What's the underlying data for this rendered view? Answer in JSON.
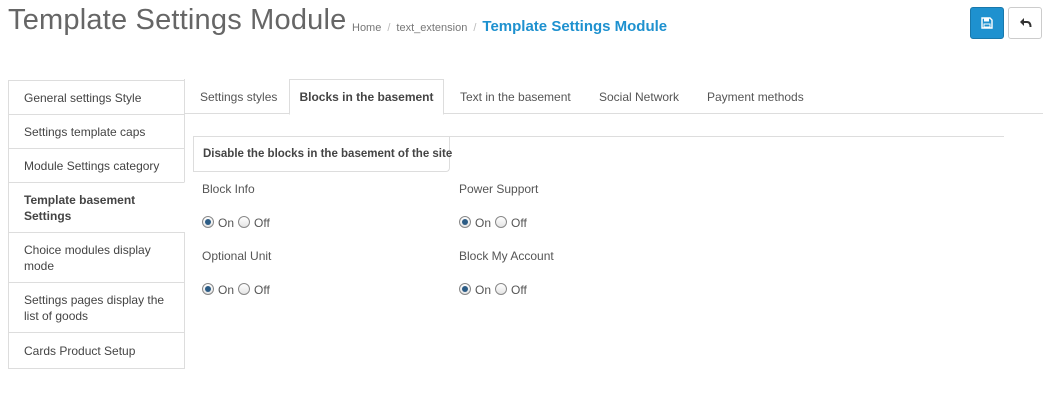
{
  "header": {
    "title": "Template Settings Module",
    "breadcrumb": [
      {
        "label": "Home"
      },
      {
        "label": "text_extension"
      },
      {
        "label": "Template Settings Module"
      }
    ],
    "separator": "/"
  },
  "buttons": {
    "save_icon": "save-icon",
    "back_icon": "reply-icon",
    "save_color": "#1e91cf"
  },
  "sidebar": {
    "items": [
      {
        "label": "General settings Style"
      },
      {
        "label": "Settings template caps"
      },
      {
        "label": "Module Settings category"
      },
      {
        "label": "Template basement Settings",
        "active": true
      },
      {
        "label": "Choice modules display mode"
      },
      {
        "label": "Settings pages display the list of goods"
      },
      {
        "label": "Cards Product Setup"
      }
    ]
  },
  "tabs": [
    {
      "label": "Settings styles"
    },
    {
      "label": "Blocks in the basement",
      "active": true
    },
    {
      "label": "Text in the basement"
    },
    {
      "label": "Social Network"
    },
    {
      "label": "Payment methods"
    }
  ],
  "section": {
    "legend": "Disable the blocks in the basement of the site"
  },
  "fields": [
    {
      "label": "Block Info",
      "selected": "On"
    },
    {
      "label": "Power Support",
      "selected": "On"
    },
    {
      "label": "Optional Unit",
      "selected": "On"
    },
    {
      "label": "Block My Account",
      "selected": "On"
    }
  ],
  "options": {
    "on": "On",
    "off": "Off"
  }
}
